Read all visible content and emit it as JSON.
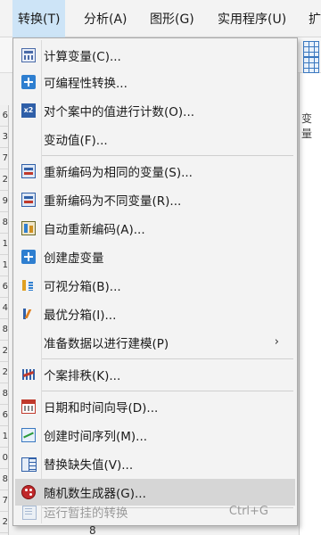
{
  "menubar": {
    "items": [
      {
        "label": "转换(T)",
        "active": true
      },
      {
        "label": "分析(A)",
        "active": false
      },
      {
        "label": "图形(G)",
        "active": false
      },
      {
        "label": "实用程序(U)",
        "active": false
      },
      {
        "label": "扩",
        "active": false
      }
    ]
  },
  "background": {
    "column_header": "变量",
    "row_numbers": [
      "6",
      "3",
      "7",
      "2",
      "9",
      "8",
      "1",
      "1",
      "6",
      "4",
      "8",
      "2",
      "2",
      "8",
      "6",
      "1",
      "0",
      "8",
      "7",
      "2"
    ],
    "bottom_value": "8"
  },
  "transform_menu": {
    "items": [
      {
        "label": "计算变量(C)...",
        "icon": "calculator-icon"
      },
      {
        "label": "可编程性转换...",
        "icon": "plus-box-icon"
      },
      {
        "label": "对个案中的值进行计数(O)...",
        "icon": "count-values-icon"
      },
      {
        "label": "变动值(F)...",
        "icon": ""
      },
      {
        "label": "重新编码为相同的变量(S)...",
        "icon": "recode-same-icon"
      },
      {
        "label": "重新编码为不同变量(R)...",
        "icon": "recode-different-icon"
      },
      {
        "label": "自动重新编码(A)...",
        "icon": "auto-recode-icon"
      },
      {
        "label": "创建虚变量",
        "icon": "plus-box-icon"
      },
      {
        "label": "可视分箱(B)...",
        "icon": "visual-binning-icon"
      },
      {
        "label": "最优分箱(I)...",
        "icon": "optimal-binning-icon"
      },
      {
        "label": "准备数据以进行建模(P)",
        "icon": "",
        "submenu_arrow": "›"
      },
      {
        "label": "个案排秩(K)...",
        "icon": "rank-cases-icon"
      },
      {
        "label": "日期和时间向导(D)...",
        "icon": "calendar-icon"
      },
      {
        "label": "创建时间序列(M)...",
        "icon": "time-series-icon"
      },
      {
        "label": "替换缺失值(V)...",
        "icon": "replace-missing-icon"
      },
      {
        "label": "随机数生成器(G)...",
        "icon": "random-dice-icon",
        "highlighted": true
      },
      {
        "label": "运行暂挂的转换",
        "icon": "run-pending-icon",
        "shortcut": "Ctrl+G",
        "disabled": true
      }
    ]
  },
  "colors": {
    "menu_bg": "#f3f3f3",
    "menubar_active": "#cde4f7",
    "row_highlight": "#d6d6d6",
    "disabled_text": "#9a9a9a"
  }
}
